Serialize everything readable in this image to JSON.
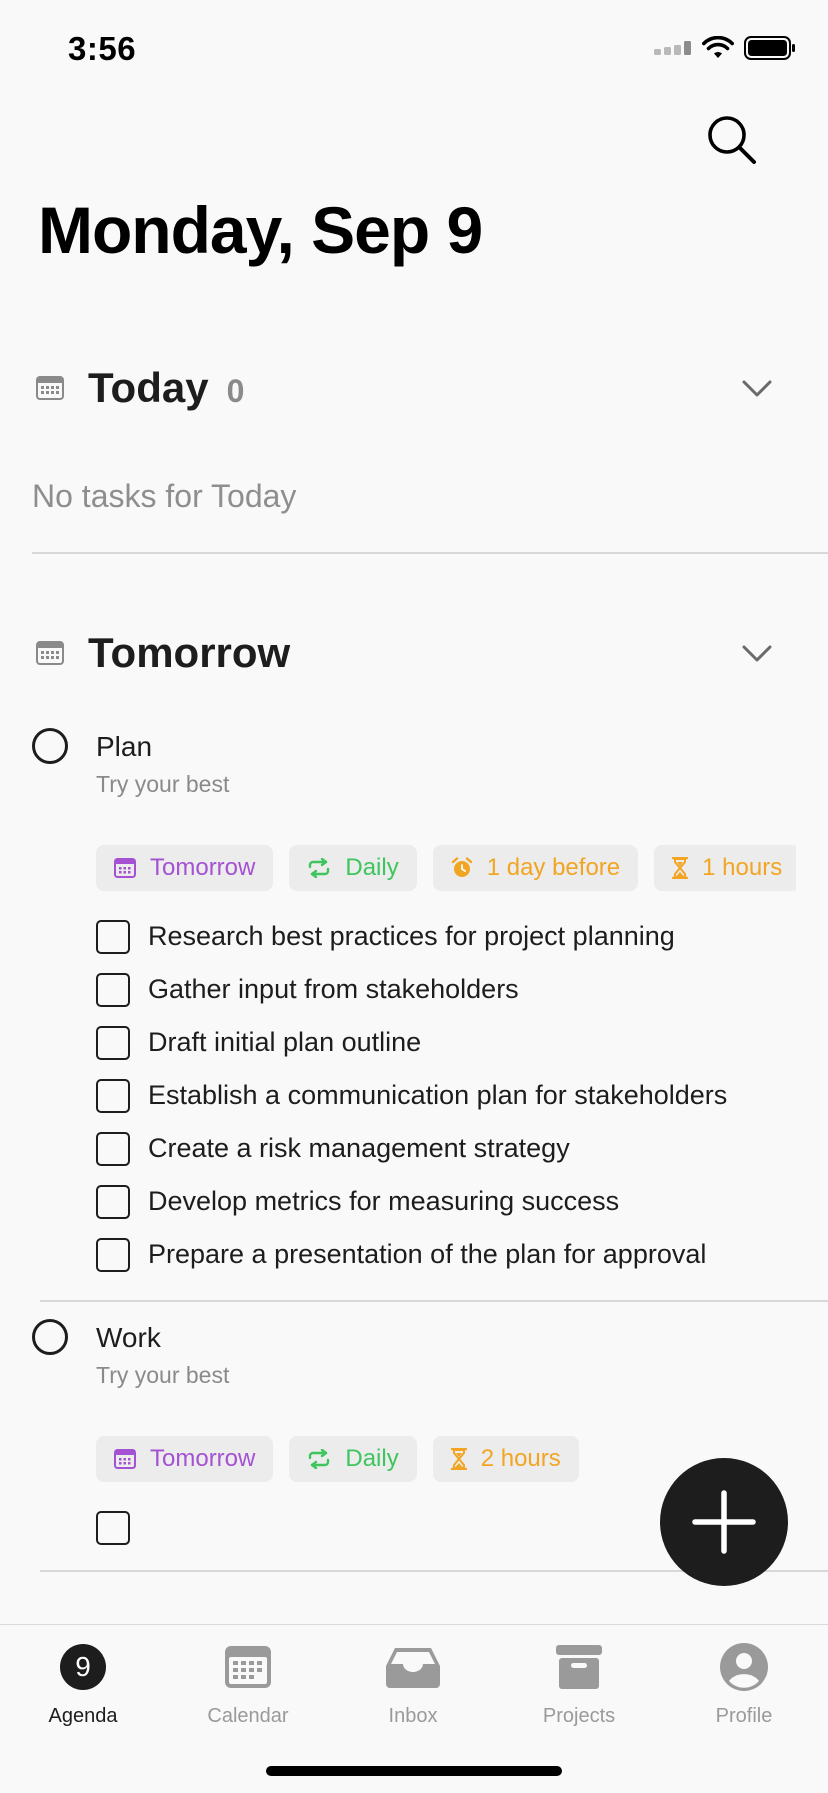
{
  "status": {
    "time": "3:56"
  },
  "header": {
    "title": "Monday, Sep 9"
  },
  "sections": {
    "today": {
      "title": "Today",
      "count": "0",
      "empty": "No tasks for Today"
    },
    "tomorrow": {
      "title": "Tomorrow"
    }
  },
  "tasks": [
    {
      "title": "Plan",
      "subtitle": "Try your best",
      "chips": [
        "Tomorrow",
        "Daily",
        "1 day before",
        "1 hours"
      ],
      "subtasks": [
        "Research best practices for project planning",
        "Gather input from stakeholders",
        "Draft initial plan outline",
        "Establish a communication plan for stakeholders",
        "Create a risk management strategy",
        "Develop metrics for measuring success",
        "Prepare a presentation of the plan for approval"
      ]
    },
    {
      "title": "Work",
      "subtitle": "Try your best",
      "chips": [
        "Tomorrow",
        "Daily",
        "2 hours"
      ],
      "subtasks": [
        ""
      ]
    }
  ],
  "tabbar": {
    "badge": "9",
    "items": [
      "Agenda",
      "Calendar",
      "Inbox",
      "Projects",
      "Profile"
    ]
  },
  "colors": {
    "purple": "#a551d3",
    "green": "#3fc55d",
    "orange": "#f2a522",
    "dark": "#1d1d1d"
  }
}
